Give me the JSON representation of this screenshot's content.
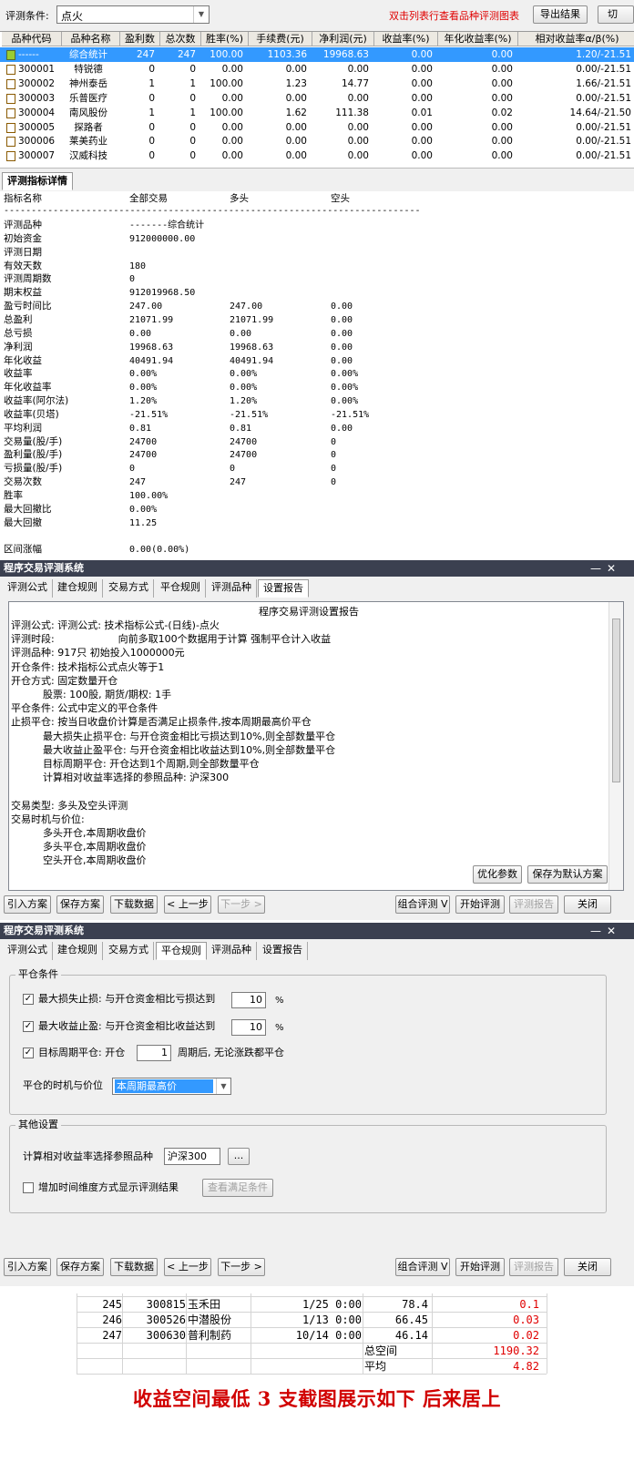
{
  "toolbar": {
    "condition_label": "评测条件:",
    "condition_value": "点火",
    "hint": "双击列表行查看品种评测图表",
    "export_button": "导出结果",
    "switch_button": "切"
  },
  "table": {
    "headers": [
      "品种代码",
      "品种名称",
      "盈利数",
      "总次数",
      "胜率(%)",
      "手续费(元)",
      "净利润(元)",
      "收益率(%)",
      "年化收益率(%)",
      "相对收益率α/β(%)"
    ],
    "rows": [
      [
        "------",
        "综合统计",
        "247",
        "247",
        "100.00",
        "1103.36",
        "19968.63",
        "0.00",
        "0.00",
        "1.20/-21.51"
      ],
      [
        "300001",
        "特锐德",
        "0",
        "0",
        "0.00",
        "0.00",
        "0.00",
        "0.00",
        "0.00",
        "0.00/-21.51"
      ],
      [
        "300002",
        "神州泰岳",
        "1",
        "1",
        "100.00",
        "1.23",
        "14.77",
        "0.00",
        "0.00",
        "1.66/-21.51"
      ],
      [
        "300003",
        "乐普医疗",
        "0",
        "0",
        "0.00",
        "0.00",
        "0.00",
        "0.00",
        "0.00",
        "0.00/-21.51"
      ],
      [
        "300004",
        "南风股份",
        "1",
        "1",
        "100.00",
        "1.62",
        "111.38",
        "0.01",
        "0.02",
        "14.64/-21.50"
      ],
      [
        "300005",
        "探路者",
        "0",
        "0",
        "0.00",
        "0.00",
        "0.00",
        "0.00",
        "0.00",
        "0.00/-21.51"
      ],
      [
        "300006",
        "莱美药业",
        "0",
        "0",
        "0.00",
        "0.00",
        "0.00",
        "0.00",
        "0.00",
        "0.00/-21.51"
      ],
      [
        "300007",
        "汉威科技",
        "0",
        "0",
        "0.00",
        "0.00",
        "0.00",
        "0.00",
        "0.00",
        "0.00/-21.51"
      ]
    ]
  },
  "detail": {
    "tab": "评测指标详情",
    "headers": [
      "指标名称",
      "全部交易",
      "多头",
      "空头"
    ],
    "separator": "----------------------------------------------------------------------------",
    "rows": [
      [
        "评测品种",
        "-------综合统计",
        "",
        ""
      ],
      [
        "初始资金",
        "912000000.00",
        "",
        ""
      ],
      [
        "评测日期",
        "",
        "",
        ""
      ],
      [
        "有效天数",
        "180",
        "",
        ""
      ],
      [
        "评测周期数",
        "0",
        "",
        ""
      ],
      [
        "期末权益",
        "912019968.50",
        "",
        ""
      ],
      [
        "盈亏时间比",
        "247.00",
        "247.00",
        "0.00"
      ],
      [
        "总盈利",
        "21071.99",
        "21071.99",
        "0.00"
      ],
      [
        "总亏损",
        "0.00",
        "0.00",
        "0.00"
      ],
      [
        "净利润",
        "19968.63",
        "19968.63",
        "0.00"
      ],
      [
        "年化收益",
        "40491.94",
        "40491.94",
        "0.00"
      ],
      [
        "收益率",
        "0.00%",
        "0.00%",
        "0.00%"
      ],
      [
        "年化收益率",
        "0.00%",
        "0.00%",
        "0.00%"
      ],
      [
        "收益率(阿尔法)",
        "1.20%",
        "1.20%",
        "0.00%"
      ],
      [
        "收益率(贝塔)",
        "-21.51%",
        "-21.51%",
        "-21.51%"
      ],
      [
        "平均利润",
        "0.81",
        "0.81",
        "0.00"
      ],
      [
        "交易量(股/手)",
        "24700",
        "24700",
        "0"
      ],
      [
        "盈利量(股/手)",
        "24700",
        "24700",
        "0"
      ],
      [
        "亏损量(股/手)",
        "0",
        "0",
        "0"
      ],
      [
        "交易次数",
        "247",
        "247",
        "0"
      ],
      [
        "胜率",
        "100.00%",
        "",
        ""
      ],
      [
        "最大回撤比",
        "0.00%",
        "",
        ""
      ],
      [
        "最大回撤",
        "11.25",
        "",
        ""
      ],
      [
        "",
        "",
        "",
        ""
      ],
      [
        "区间涨幅",
        "0.00(0.00%)",
        "",
        ""
      ]
    ]
  },
  "window1": {
    "title": "程序交易评测系统",
    "min": "—",
    "close": "✕",
    "tabs": [
      "评测公式",
      "建仓规则",
      "交易方式",
      "平仓规则",
      "评测品种",
      "设置报告"
    ],
    "report_title": "程序交易评测设置报告",
    "report_lines": [
      "评测公式: 评测公式: 技术指标公式-(日线)-点火",
      "评测时段:                    向前多取100个数据用于计算 强制平仓计入收益",
      "评测品种: 917只 初始投入1000000元",
      "开仓条件: 技术指标公式点火等于1",
      "开仓方式: 固定数量开仓",
      "          股票: 100股, 期货/期权: 1手",
      "平仓条件: 公式中定义的平仓条件",
      "止损平仓: 按当日收盘价计算是否满足止损条件,按本周期最高价平仓",
      "          最大损失止损平仓: 与开仓资金相比亏损达到10%,则全部数量平仓",
      "          最大收益止盈平仓: 与开仓资金相比收益达到10%,则全部数量平仓",
      "          目标周期平仓: 开仓达到1个周期,则全部数量平仓",
      "          计算相对收益率选择的参照品种: 沪深300",
      "",
      "交易类型: 多头及空头评测",
      "交易时机与价位:",
      "          多头开仓,本周期收盘价",
      "          多头平仓,本周期收盘价",
      "          空头开仓,本周期收盘价"
    ],
    "optimize": "优化参数",
    "save_default": "保存为默认方案"
  },
  "nav": {
    "import": "引入方案",
    "save": "保存方案",
    "download": "下载数据",
    "prev": "< 上一步",
    "next": "下一步 >",
    "combo": "组合评测 V",
    "start": "开始评测",
    "report": "评测报告",
    "close": "关闭"
  },
  "window2": {
    "title": "程序交易评测系统",
    "min": "—",
    "close": "✕",
    "tabs": [
      "评测公式",
      "建仓规则",
      "交易方式",
      "平仓规则",
      "评测品种",
      "设置报告"
    ],
    "group1": "平仓条件",
    "stop_loss_label": "最大损失止损: 与开仓资金相比亏损达到",
    "stop_loss_value": "10",
    "stop_loss_unit": "%",
    "take_profit_label": "最大收益止盈: 与开仓资金相比收益达到",
    "take_profit_value": "10",
    "take_profit_unit": "%",
    "target_label": "目标周期平仓: 开仓",
    "target_value": "1",
    "target_suffix": "周期后, 无论涨跌都平仓",
    "timing_label": "平仓的时机与价位",
    "timing_value": "本周期最高价",
    "group2": "其他设置",
    "ref_label": "计算相对收益率选择参照品种",
    "ref_value": "沪深300",
    "ref_btn": "...",
    "time_dim_label": "增加时间维度方式显示评测结果",
    "check_btn": "查看满足条件"
  },
  "bottom": {
    "rows": [
      [
        "245",
        "300815",
        "玉禾田",
        "1/25 0:00",
        "78.4",
        "0.1"
      ],
      [
        "246",
        "300526",
        "中潜股份",
        "1/13 0:00",
        "66.45",
        "0.03"
      ],
      [
        "247",
        "300630",
        "普利制药",
        "10/14 0:00",
        "46.14",
        "0.02"
      ]
    ],
    "total_label": "总空间",
    "total_value": "1190.32",
    "avg_label": "平均",
    "avg_value": "4.82",
    "caption": "收益空间最低 3 支截图展示如下 后来居上"
  }
}
